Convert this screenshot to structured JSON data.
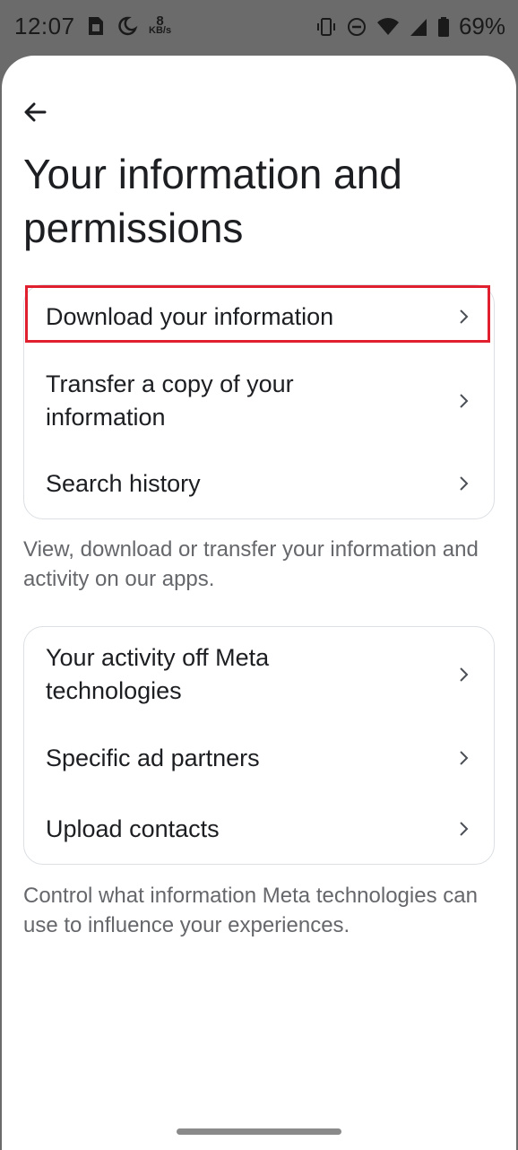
{
  "status_bar": {
    "time": "12:07",
    "network_speed_value": "8",
    "network_speed_unit": "KB/s",
    "battery": "69%"
  },
  "page": {
    "title": "Your information and permissions"
  },
  "section1": {
    "items": [
      {
        "label": "Download your information"
      },
      {
        "label": "Transfer a copy of your information"
      },
      {
        "label": "Search history"
      }
    ],
    "caption": "View, download or transfer your information and activity on our apps."
  },
  "section2": {
    "items": [
      {
        "label": "Your activity off Meta technologies"
      },
      {
        "label": "Specific ad partners"
      },
      {
        "label": "Upload contacts"
      }
    ],
    "caption": "Control what information Meta technologies can use to influence your experiences."
  },
  "colors": {
    "highlight": "#e0202e",
    "text_primary": "#1c1e21",
    "text_secondary": "#65676b"
  }
}
